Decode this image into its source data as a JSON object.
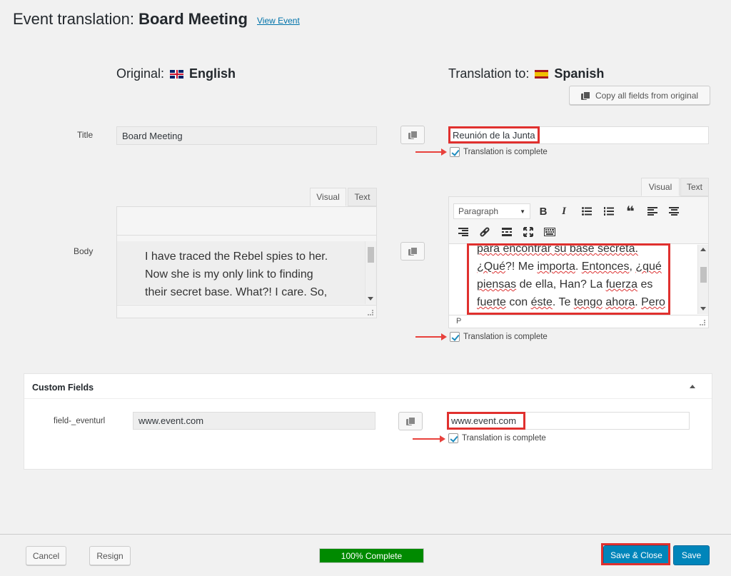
{
  "header": {
    "title_prefix": "Event translation: ",
    "title_name": "Board Meeting",
    "view_link": "View Event"
  },
  "original": {
    "heading": "Original:",
    "language": "English",
    "flag": "uk-flag-icon"
  },
  "translation": {
    "heading": "Translation to:",
    "language": "Spanish",
    "flag": "spain-flag-icon"
  },
  "copy_all_label": "Copy all fields from original",
  "rows": {
    "title": {
      "label": "Title",
      "original_value": "Board Meeting",
      "translated_value": "Reunión de la Junta",
      "complete_label": "Translation is complete"
    },
    "body": {
      "label": "Body",
      "tabs": [
        "Visual",
        "Text"
      ],
      "original_lines": [
        "I have traced the Rebel spies to her.",
        "Now she is my only link to finding",
        "their secret base. What?! I care. So,"
      ],
      "translated_first_line": "para encontrar su base secreta.",
      "translated_lines_parts": {
        "l1a": "¿Qué",
        "l1b": "?! Me ",
        "l1c": "importa",
        "l1d": ". ",
        "l1e": "Entonces",
        "l1f": ", ",
        "l1g": "¿qué",
        "l2a": "piensas",
        "l2b": " de ella, Han? La ",
        "l2c": "fuerza",
        "l2d": " es",
        "l3a": "fuerte",
        "l3b": " con ",
        "l3c": "éste",
        "l3d": ". Te ",
        "l3e": "tengo",
        "l3f": " ",
        "l3g": "ahora",
        "l3h": ". ",
        "l3i": "Pero"
      },
      "toolbar": {
        "format_select": "Paragraph",
        "bold": "B",
        "italic": "I",
        "quote": "❝"
      },
      "status_path": "P",
      "complete_label": "Translation is complete"
    }
  },
  "custom_fields": {
    "title": "Custom Fields",
    "field_label": "field-_eventurl",
    "original_value": "www.event.com",
    "translated_value": "www.event.com",
    "complete_label": "Translation is complete"
  },
  "footer": {
    "cancel": "Cancel",
    "resign": "Resign",
    "progress": "100% Complete",
    "progress_value": 100,
    "save_close": "Save & Close",
    "save": "Save"
  },
  "colors": {
    "accent": "#0085ba",
    "highlight": "#e0302e",
    "progress": "#008a00",
    "link": "#0073aa"
  }
}
